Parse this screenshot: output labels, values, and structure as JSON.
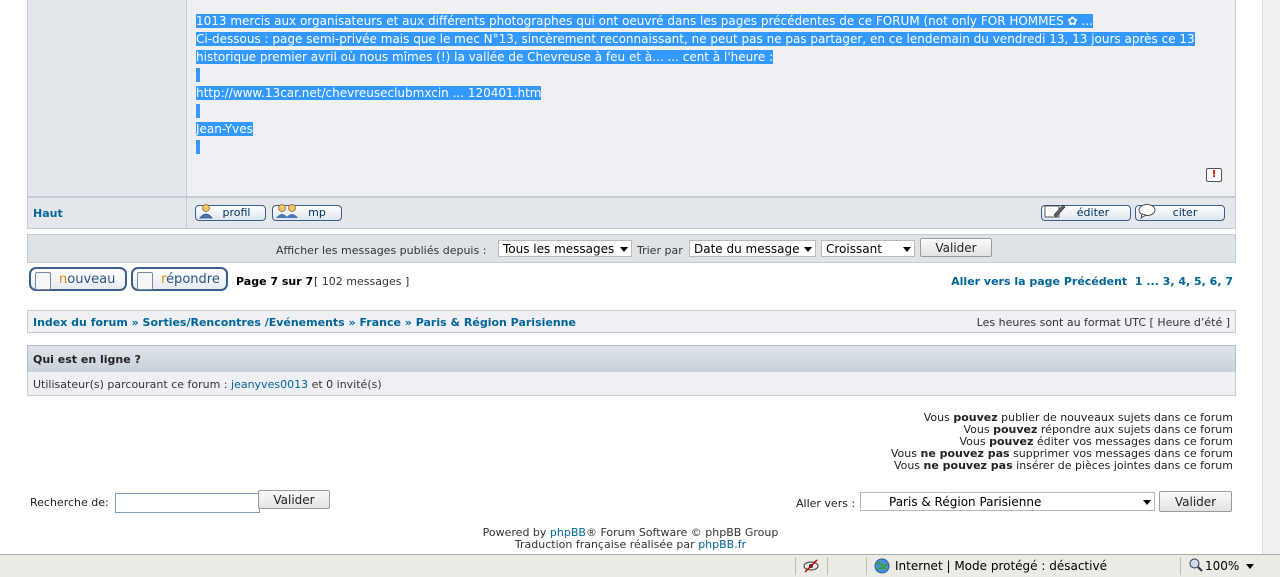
{
  "post": {
    "lines": [
      "1013 mercis aux organisateurs et aux différents photographes qui ont oeuvré dans les pages précédentes de ce FORUM (not only FOR HOMMES",
      "Ci-dessous : page semi-privée mais que le mec N°13, sincèrement reconnaissant, ne peut pas ne pas partager, en ce lendemain du vendredi 13, 13 jours après ce 13",
      "historique premier avril où nous mîmes (!) la vallée de Chevreuse à feu et à... ... cent à l'heure :",
      "http://www.13car.net/chevreuseclubmxcin ... 120401.htm",
      "Jean-Yves"
    ],
    "line1_suffix": " ...",
    "report_icon": "!"
  },
  "postbar": {
    "haut": "Haut",
    "profil": "profil",
    "mp": "mp",
    "editer": "éditer",
    "citer": "citer"
  },
  "filter": {
    "since_label": "Afficher les messages publiés depuis :",
    "since_value": "Tous les messages",
    "sort_label": "Trier par",
    "sort_value": "Date du message",
    "order_value": "Croissant",
    "submit": "Valider"
  },
  "actions": {
    "new_first": "n",
    "new_rest": "ouveau",
    "reply_first": "r",
    "reply_rest": "épondre",
    "page_info": "Page 7 sur 7",
    "messages_count": "[ 102 messages ]",
    "goto": "Aller vers la page Précédent  1 ... 3, 4, 5, 6, 7"
  },
  "breadcrumb": {
    "links": "Index du forum » Sorties/Rencontres /Evénements » France » Paris & Région Parisienne",
    "timezone": "Les heures sont au format UTC [ Heure d’été ]"
  },
  "online": {
    "title": "Qui est en ligne ?",
    "prefix": "Utilisateur(s) parcourant ce forum : ",
    "user": "jeanyves0013",
    "suffix": " et 0 invité(s)"
  },
  "permissions": [
    {
      "pre": "Vous ",
      "bold": "pouvez",
      "post": " publier de nouveaux sujets dans ce forum"
    },
    {
      "pre": "Vous ",
      "bold": "pouvez",
      "post": " répondre aux sujets dans ce forum"
    },
    {
      "pre": "Vous ",
      "bold": "pouvez",
      "post": " éditer vos messages dans ce forum"
    },
    {
      "pre": "Vous ",
      "bold": "ne pouvez pas",
      "post": " supprimer vos messages dans ce forum"
    },
    {
      "pre": "Vous ",
      "bold": "ne pouvez pas",
      "post": " insérer de pièces jointes dans ce forum"
    }
  ],
  "search": {
    "label": "Recherche de:",
    "value": "",
    "submit": "Valider"
  },
  "jump": {
    "label": "Aller vers :",
    "value": "Paris & Région Parisienne",
    "submit": "Valider"
  },
  "footer": {
    "line1_pre": "Powered by ",
    "line1_link": "phpBB",
    "line1_post": "® Forum Software © phpBB Group",
    "line2_pre": "Traduction française réalisée par ",
    "line2_link": "phpBB.fr"
  },
  "statusbar": {
    "zone": "Internet | Mode protégé : désactivé",
    "zoom": "100%"
  }
}
